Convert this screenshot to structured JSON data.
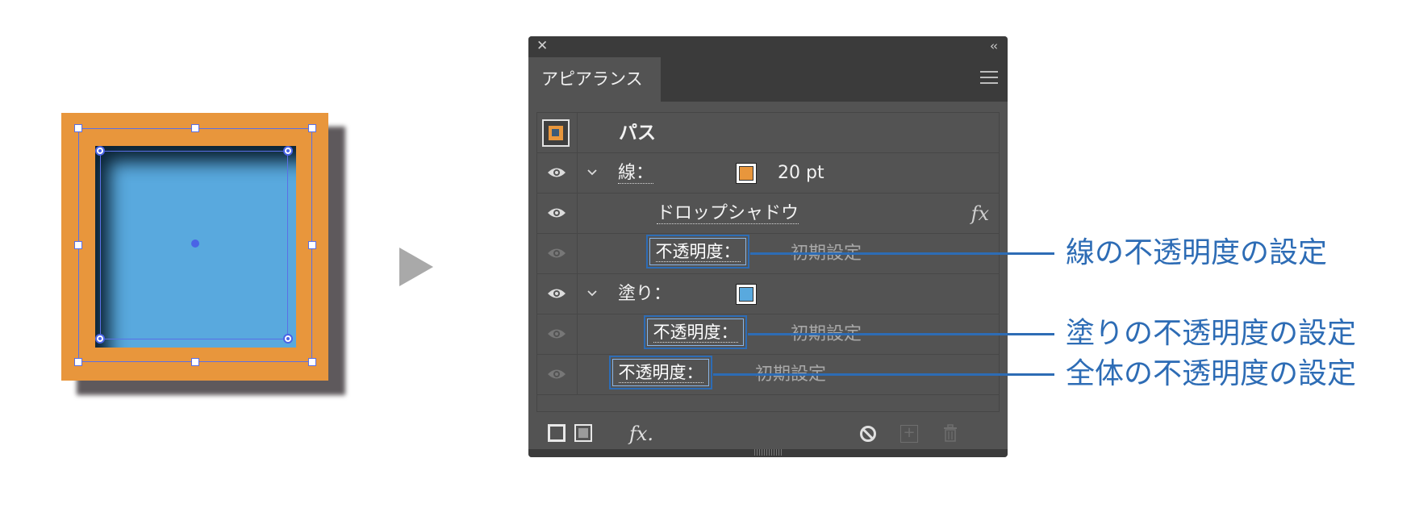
{
  "panel": {
    "title": "アピアランス",
    "rows": {
      "path": "パス",
      "stroke_label": "線：",
      "stroke_weight": "20 pt",
      "effect": "ドロップシャドウ",
      "stroke_opacity_label": "不透明度：",
      "stroke_opacity_value": "初期設定",
      "fill_label": "塗り：",
      "fill_opacity_label": "不透明度：",
      "fill_opacity_value": "初期設定",
      "overall_opacity_label": "不透明度：",
      "overall_opacity_value": "初期設定"
    }
  },
  "callouts": {
    "stroke_opacity": "線の不透明度の設定",
    "fill_opacity": "塗りの不透明度の設定",
    "overall_opacity": "全体の不透明度の設定"
  },
  "colors": {
    "stroke": "#e8963c",
    "fill": "#59a9de",
    "callout": "#2d6cb5",
    "panel_bg": "#535353"
  },
  "icons": {
    "close": "close-icon",
    "collapse": "collapse-icon",
    "menu": "hamburger-menu-icon",
    "visibility": "eye-icon",
    "disclosure": "chevron-down-icon",
    "effect": "fx-icon",
    "add_stroke": "add-stroke-icon",
    "add_fill": "add-fill-icon",
    "add_effect": "add-effect-icon",
    "clear": "clear-appearance-icon",
    "duplicate": "duplicate-item-icon",
    "delete": "trash-icon"
  }
}
